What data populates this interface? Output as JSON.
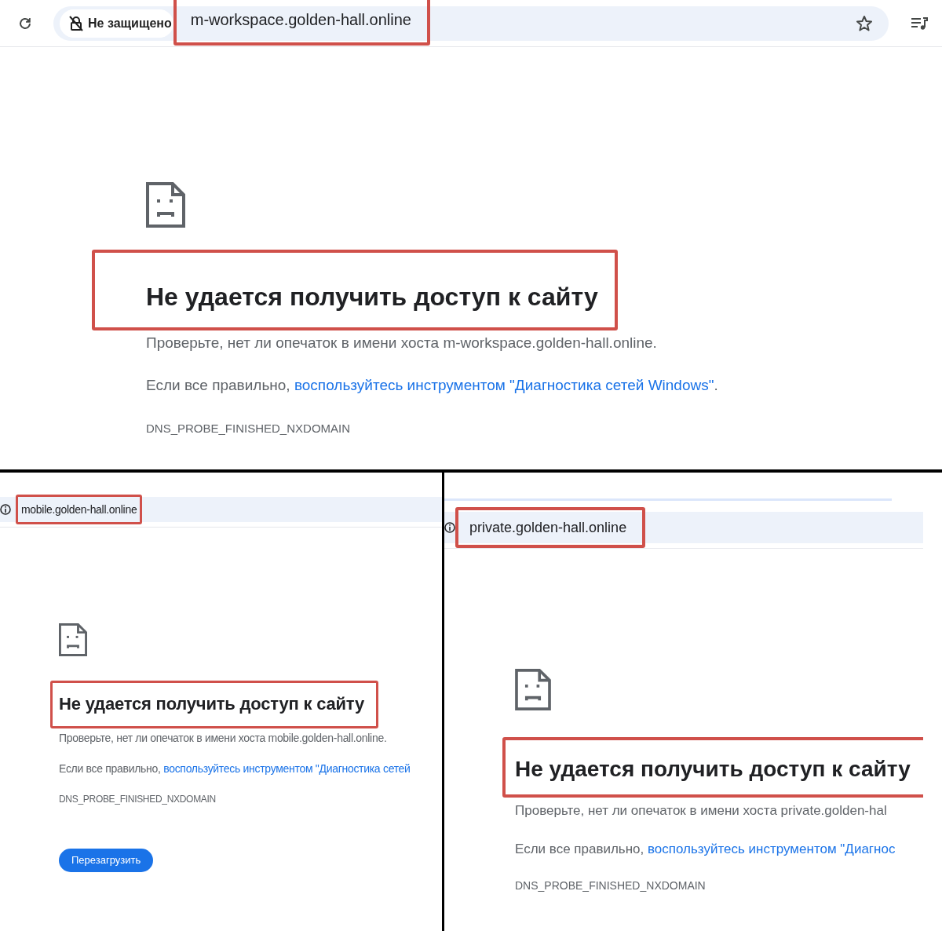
{
  "panels": [
    {
      "kind": "full",
      "address_bar": {
        "security_label": "Не защищено",
        "url": "m-workspace.golden-hall.online",
        "url_highlighted": true
      },
      "error": {
        "title": "Не удается получить доступ к сайту",
        "title_highlighted": true,
        "hint": "Проверьте, нет ли опечаток в имени хоста m-workspace.golden-hall.online.",
        "diagnose_prefix": "Если все правильно,",
        "diagnose_link": "воспользуйтесь инструментом \"Диагностика сетей Windows\"",
        "diagnose_suffix": ".",
        "code": "DNS_PROBE_FINISHED_NXDOMAIN"
      }
    },
    {
      "kind": "cropped",
      "address_bar": {
        "url": "mobile.golden-hall.online",
        "url_highlighted": true
      },
      "error": {
        "title": "Не удается получить доступ к сайту",
        "title_highlighted": true,
        "hint": "Проверьте, нет ли опечаток в имени хоста mobile.golden-hall.online.",
        "diagnose_prefix": "Если все правильно,",
        "diagnose_link": "воспользуйтесь инструментом \"Диагностика сетей",
        "code": "DNS_PROBE_FINISHED_NXDOMAIN",
        "reload_button": "Перезагрузить"
      }
    },
    {
      "kind": "cropped",
      "address_bar": {
        "url": "private.golden-hall.online",
        "url_highlighted": true
      },
      "error": {
        "title": "Не удается получить доступ к сайту",
        "title_highlighted": true,
        "hint": "Проверьте, нет ли опечаток в имени хоста private.golden-hal",
        "diagnose_prefix": "Если все правильно,",
        "diagnose_link": "воспользуйтесь инструментом \"Диагнос",
        "code": "DNS_PROBE_FINISHED_NXDOMAIN"
      }
    }
  ]
}
